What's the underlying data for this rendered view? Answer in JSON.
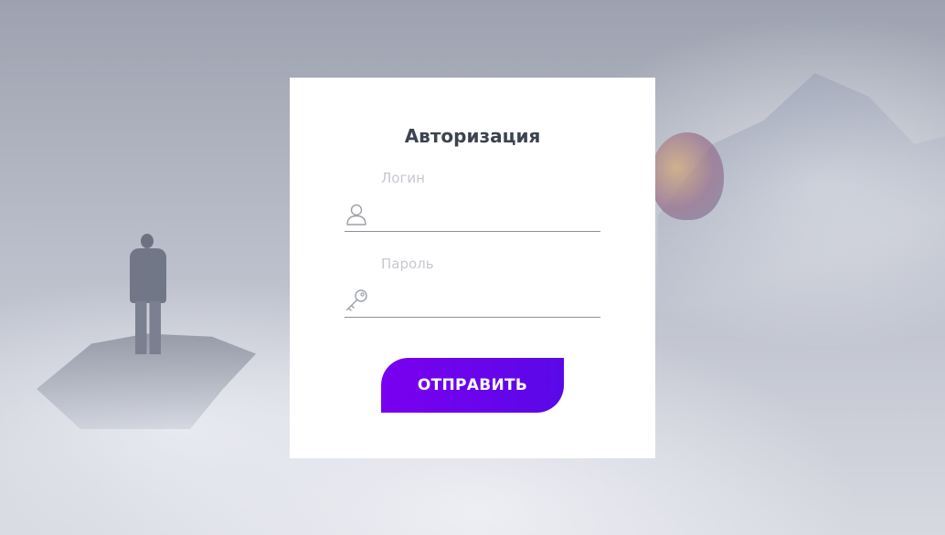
{
  "form": {
    "title": "Авторизация",
    "login": {
      "label": "Логин",
      "value": "",
      "icon": "user-icon"
    },
    "password": {
      "label": "Пароль",
      "value": "",
      "icon": "key-icon"
    },
    "submit_label": "ОТПРАВИТЬ"
  },
  "colors": {
    "accent_start": "#7a00f0",
    "accent_end": "#5a08e8",
    "title": "#3d4350",
    "label": "#c6c8cf"
  }
}
